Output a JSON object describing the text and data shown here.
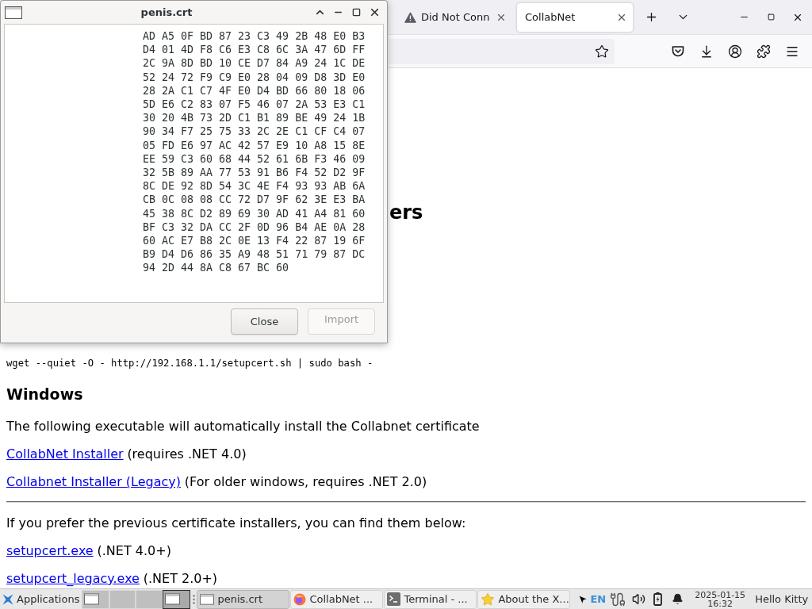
{
  "dialog": {
    "title": "penis.crt",
    "lines": [
      "AD A5 0F BD 87 23 C3 49 2B 48 E0 B3",
      "D4 01 4D F8 C6 E3 C8 6C 3A 47 6D FF",
      "2C 9A 8D BD 10 CE D7 84 A9 24 1C DE",
      "52 24 72 F9 C9 E0 28 04 09 D8 3D E0",
      "28 2A C1 C7 4F E0 D4 BD 66 80 18 06",
      "5D E6 C2 83 07 F5 46 07 2A 53 E3 C1",
      "30 20 4B 73 2D C1 B1 89 BE 49 24 1B",
      "90 34 F7 25 75 33 2C 2E C1 CF C4 07",
      "05 FD E6 97 AC 42 57 E9 10 A8 15 8E",
      "EE 59 C3 60 68 44 52 61 6B F3 46 09",
      "32 5B 89 AA 77 53 91 B6 F4 52 D2 9F",
      "8C DE 92 8D 54 3C 4E F4 93 93 AB 6A",
      "CB 0C 08 08 CC 72 D7 9F 62 3E E3 BA",
      "45 38 8C D2 89 69 30 AD 41 A4 81 60",
      "BF C3 32 DA CC 2F 0D 96 B4 AE 0A 28",
      "60 AC E7 B8 2C 0E 13 F4 22 87 19 6F",
      "B9 D4 D6 86 35 A9 48 51 71 79 87 DC",
      "94 2D 44 8A C8 67 BC 60"
    ],
    "buttons": [
      {
        "label": "Close",
        "disabled": false
      },
      {
        "label": "Import",
        "disabled": true
      }
    ]
  },
  "browser": {
    "tabs": [
      {
        "label": "Did Not Conn",
        "kind": "warning",
        "selected": false
      },
      {
        "label": "CollabNet",
        "kind": "page",
        "selected": true
      }
    ]
  },
  "page": {
    "heading": "ers",
    "command": "wget --quiet -O - http://192.168.1.1/setupcert.sh | sudo bash -",
    "section_title": "Windows",
    "intro": "The following executable will automatically install the Collabnet certificate",
    "installers": [
      {
        "link": "CollabNet Installer",
        "note": "(requires .NET 4.0)"
      },
      {
        "link": "Collabnet Installer (Legacy)",
        "note": "(For older windows, requires .NET 2.0)"
      }
    ],
    "legacy_intro": "If you prefer the previous certificate installers, you can find them below:",
    "legacy_installers": [
      {
        "link": "setupcert.exe",
        "note": "(.NET 4.0+)"
      },
      {
        "link": "setupcert_legacy.exe",
        "note": "(.NET 2.0+)"
      }
    ]
  },
  "taskbar": {
    "menu_label": "Applications",
    "workspaces": [
      {
        "selected": false,
        "occupied": true
      },
      {
        "selected": false,
        "occupied": false
      },
      {
        "selected": false,
        "occupied": false
      },
      {
        "selected": true,
        "occupied": true
      }
    ],
    "tasks": [
      {
        "label": "penis.crt",
        "kind": "window",
        "selected": true
      },
      {
        "label": "CollabNet ...",
        "kind": "browser",
        "selected": false
      },
      {
        "label": "Terminal - ...",
        "kind": "terminal",
        "selected": false
      },
      {
        "label": "About the X...",
        "kind": "star",
        "selected": false
      }
    ],
    "keyboard_layout": "EN",
    "clock": {
      "date": "2025-01-15",
      "time": "16:32"
    },
    "user": "Hello Kitty"
  }
}
